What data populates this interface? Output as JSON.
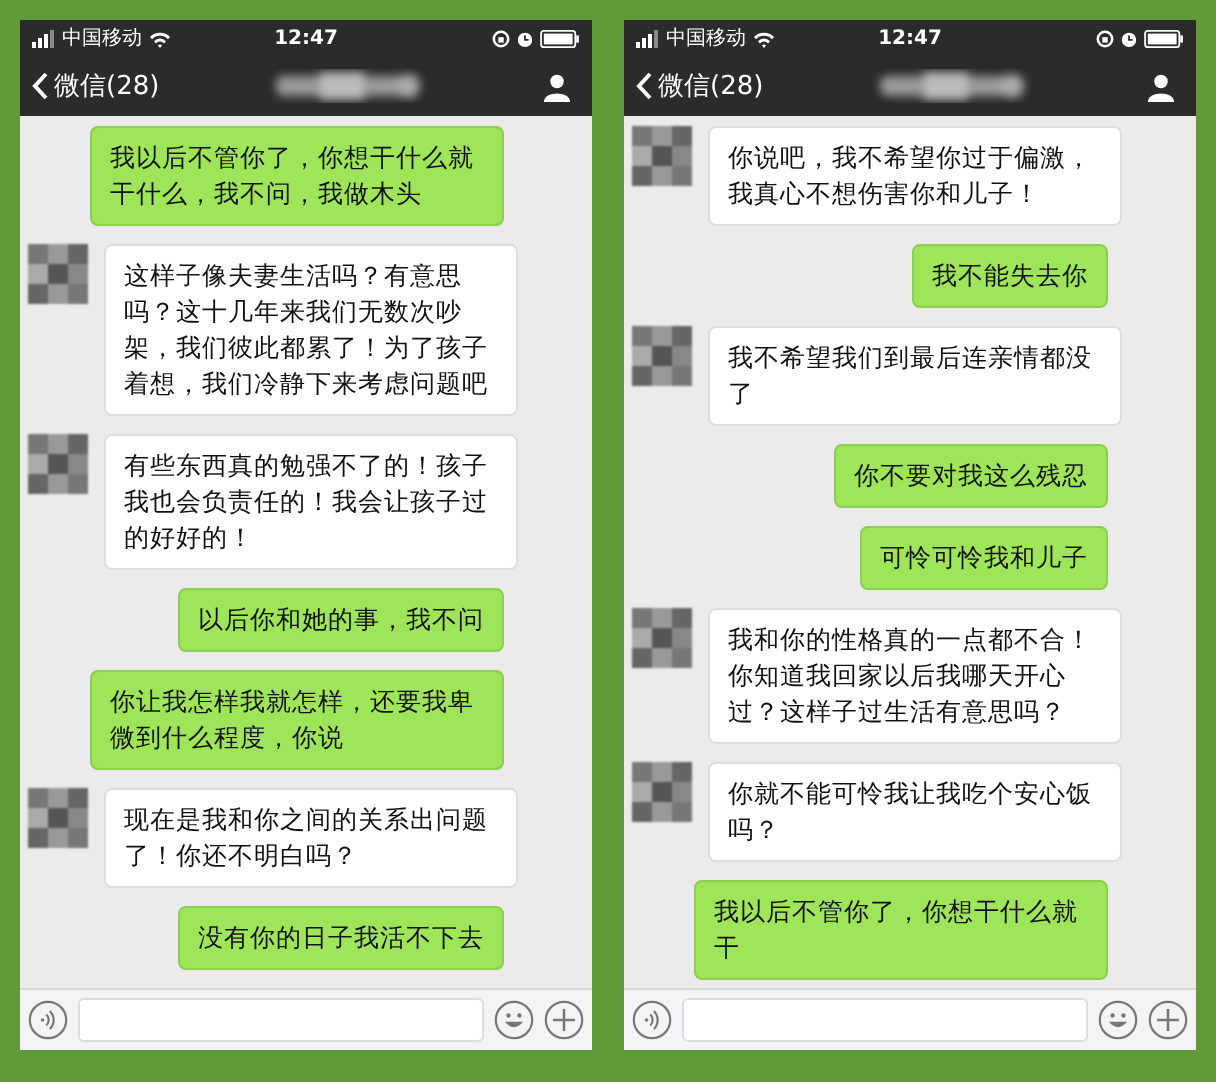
{
  "screens": [
    {
      "status_bar": {
        "carrier": "中国移动",
        "time": "12:47"
      },
      "nav": {
        "back_label": "微信(28)"
      },
      "messages": [
        {
          "kind": "sent",
          "text": "我以后不管你了，你想干什么就干什么，我不问，我做木头"
        },
        {
          "kind": "received",
          "text": "这样子像夫妻生活吗？有意思吗？这十几年来我们无数次吵架，我们彼此都累了！为了孩子着想，我们冷静下来考虑问题吧"
        },
        {
          "kind": "received",
          "text": "有些东西真的勉强不了的！孩子我也会负责任的！我会让孩子过的好好的！"
        },
        {
          "kind": "sent",
          "text": "以后你和她的事，我不问"
        },
        {
          "kind": "sent",
          "text": "你让我怎样我就怎样，还要我卑微到什么程度，你说"
        },
        {
          "kind": "received",
          "text": "现在是我和你之间的关系出问题了！你还不明白吗？"
        },
        {
          "kind": "sent",
          "text": "没有你的日子我活不下去"
        }
      ]
    },
    {
      "status_bar": {
        "carrier": "中国移动",
        "time": "12:47"
      },
      "nav": {
        "back_label": "微信(28)"
      },
      "messages": [
        {
          "kind": "received",
          "text": "你说吧，我不希望你过于偏激，我真心不想伤害你和儿子！"
        },
        {
          "kind": "sent",
          "text": "我不能失去你"
        },
        {
          "kind": "received",
          "text": "我不希望我们到最后连亲情都没了"
        },
        {
          "kind": "sent",
          "text": "你不要对我这么残忍"
        },
        {
          "kind": "sent",
          "text": "可怜可怜我和儿子"
        },
        {
          "kind": "received",
          "text": "我和你的性格真的一点都不合！你知道我回家以后我哪天开心过？这样子过生活有意思吗？"
        },
        {
          "kind": "received",
          "text": "你就不能可怜我让我吃个安心饭吗？"
        },
        {
          "kind": "sent",
          "text": "我以后不管你了，你想干什么就干"
        }
      ]
    }
  ]
}
